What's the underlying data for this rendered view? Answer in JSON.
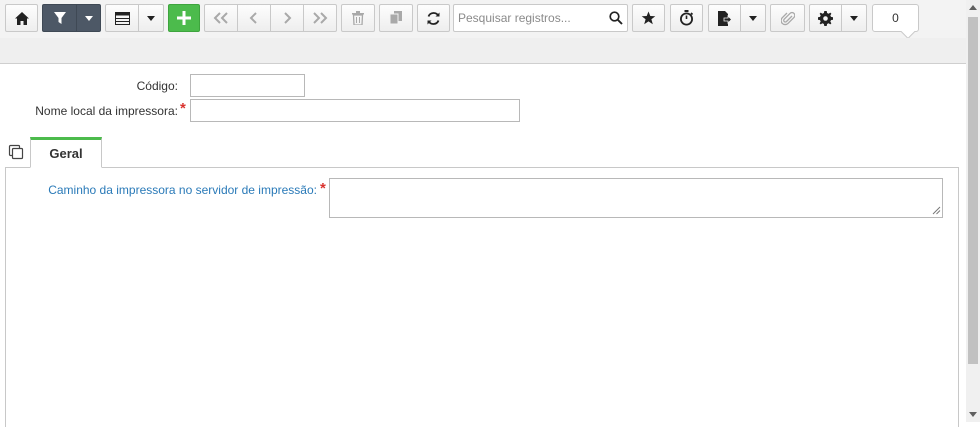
{
  "toolbar": {
    "search_placeholder": "Pesquisar registros...",
    "counter": "0"
  },
  "form": {
    "codigo_label": "Código:",
    "codigo_value": "",
    "nome_label": "Nome local da impressora:",
    "nome_value": "",
    "required_mark": "*"
  },
  "tabs": [
    {
      "label": "Geral",
      "active": true
    }
  ],
  "geral": {
    "caminho_label": "Caminho da impressora no servidor de impressão:",
    "caminho_value": "",
    "required_mark": "*"
  },
  "colors": {
    "accent_green": "#4cbb4c",
    "required_red": "#d9322e",
    "link_blue": "#2a7ab8",
    "dark_button": "#4d5866"
  },
  "icons": {
    "home": "home-icon",
    "filter": "filter-icon",
    "view": "list-view-icon",
    "add": "plus-icon",
    "first": "double-chevron-left-icon",
    "prev": "chevron-left-icon",
    "next": "chevron-right-icon",
    "last": "double-chevron-right-icon",
    "delete": "trash-icon",
    "copy": "copy-icon",
    "refresh": "refresh-icon",
    "search": "search-icon",
    "favorite": "star-icon",
    "timer": "stopwatch-icon",
    "export": "export-document-icon",
    "attach": "paperclip-icon",
    "settings": "gear-icon",
    "clone": "duplicate-icon"
  }
}
